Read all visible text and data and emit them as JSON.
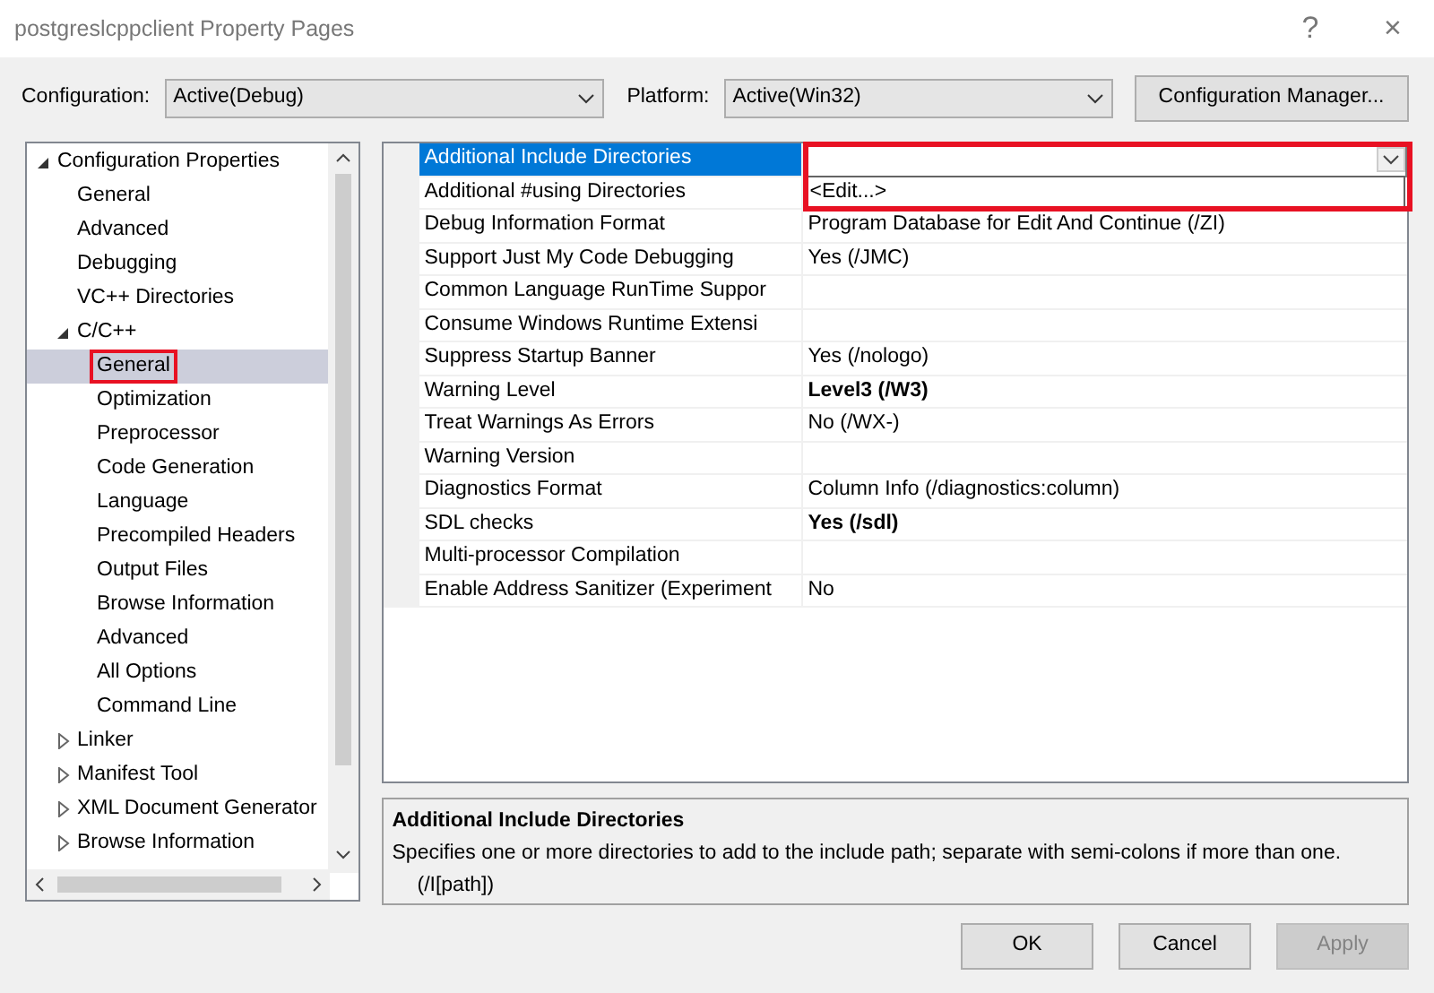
{
  "window": {
    "title": "postgreslcppclient Property Pages",
    "help": "?",
    "close": "×"
  },
  "configuration": {
    "label": "Configuration:",
    "value": "Active(Debug)"
  },
  "platform": {
    "label": "Platform:",
    "value": "Active(Win32)"
  },
  "configuration_manager": "Configuration Manager...",
  "tree": [
    {
      "label": "Configuration Properties",
      "expanded": true,
      "selected": false,
      "children": [
        {
          "label": "General",
          "selected": false
        },
        {
          "label": "Advanced",
          "selected": false
        },
        {
          "label": "Debugging",
          "selected": false
        },
        {
          "label": "VC++ Directories",
          "selected": false
        },
        {
          "label": "C/C++",
          "expanded": true,
          "selected": false,
          "children": [
            {
              "label": "General",
              "selected": true,
              "highlighted": true
            },
            {
              "label": "Optimization",
              "selected": false
            },
            {
              "label": "Preprocessor",
              "selected": false
            },
            {
              "label": "Code Generation",
              "selected": false
            },
            {
              "label": "Language",
              "selected": false
            },
            {
              "label": "Precompiled Headers",
              "selected": false
            },
            {
              "label": "Output Files",
              "selected": false
            },
            {
              "label": "Browse Information",
              "selected": false
            },
            {
              "label": "Advanced",
              "selected": false
            },
            {
              "label": "All Options",
              "selected": false
            },
            {
              "label": "Command Line",
              "selected": false
            }
          ]
        },
        {
          "label": "Linker",
          "expanded": false,
          "selected": false
        },
        {
          "label": "Manifest Tool",
          "expanded": false,
          "selected": false
        },
        {
          "label": "XML Document Generator",
          "expanded": false,
          "selected": false
        },
        {
          "label": "Browse Information",
          "expanded": false,
          "selected": false
        }
      ]
    }
  ],
  "properties": [
    {
      "name": "Additional Include Directories",
      "selected": true
    },
    {
      "name": "Additional #using Directories",
      "selected": false
    },
    {
      "name": "Debug Information Format",
      "value": "Program Database for Edit And Continue (/ZI)",
      "selected": false,
      "bold": false
    },
    {
      "name": "Support Just My Code Debugging",
      "value": "Yes (/JMC)",
      "selected": false,
      "bold": false
    },
    {
      "name": "Common Language RunTime Suppor",
      "selected": false
    },
    {
      "name": "Consume Windows Runtime Extensi",
      "selected": false
    },
    {
      "name": "Suppress Startup Banner",
      "value": "Yes (/nologo)",
      "selected": false,
      "bold": false
    },
    {
      "name": "Warning Level",
      "value": "Level3 (/W3)",
      "selected": false,
      "bold": true
    },
    {
      "name": "Treat Warnings As Errors",
      "value": "No (/WX-)",
      "selected": false,
      "bold": false
    },
    {
      "name": "Warning Version",
      "selected": false
    },
    {
      "name": "Diagnostics Format",
      "value": "Column Info (/diagnostics:column)",
      "selected": false,
      "bold": false
    },
    {
      "name": "SDL checks",
      "value": "Yes (/sdl)",
      "selected": false,
      "bold": true
    },
    {
      "name": "Multi-processor Compilation",
      "selected": false
    },
    {
      "name": "Enable Address Sanitizer (Experiment",
      "value": "No",
      "selected": false,
      "bold": false
    }
  ],
  "dropdown": {
    "option": "<Edit...>",
    "highlighted": true
  },
  "description": {
    "title": "Additional Include Directories",
    "text": "Specifies one or more directories to add to the include path; separate with semi-colons if more than one. (/I[path])"
  },
  "buttons": [
    {
      "label": "OK",
      "disabled": false
    },
    {
      "label": "Cancel",
      "disabled": false
    },
    {
      "label": "Apply",
      "disabled": true
    }
  ]
}
